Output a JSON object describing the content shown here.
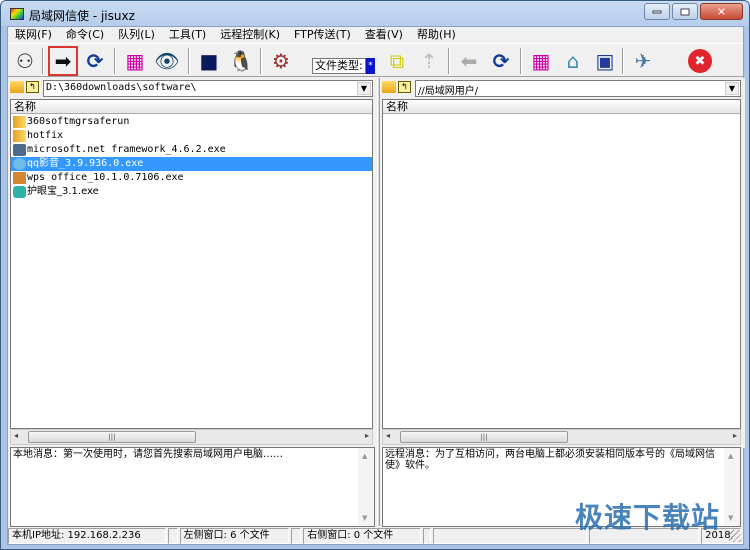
{
  "window": {
    "title": "局域网信使 - jisuxz",
    "controls": {
      "minimize": "minimize",
      "maximize": "maximize",
      "close": "close"
    }
  },
  "menu": [
    {
      "label": "联网(F)"
    },
    {
      "label": "命令(C)"
    },
    {
      "label": "队列(L)"
    },
    {
      "label": "工具(T)"
    },
    {
      "label": "远程控制(K)"
    },
    {
      "label": "FTP传送(T)"
    },
    {
      "label": "查看(V)"
    },
    {
      "label": "帮助(H)"
    }
  ],
  "toolbar": {
    "left": [
      {
        "icon": "network-computers-icon",
        "glyph": "⚇"
      },
      {
        "icon": "send-arrow-icon",
        "glyph": "➡",
        "selected": true
      },
      {
        "icon": "refresh-icon",
        "glyph": "⟳"
      },
      {
        "icon": "color-monitor-icon",
        "glyph": "▦"
      },
      {
        "icon": "eye-folder-icon",
        "glyph": "👁"
      },
      {
        "icon": "screen-monitor-icon",
        "glyph": "■"
      },
      {
        "icon": "penguin-icon",
        "glyph": "🐧"
      },
      {
        "icon": "tools-icon",
        "glyph": "⚙"
      }
    ],
    "file_type_label": "文件类型:",
    "file_type_value": "*",
    "right": [
      {
        "icon": "computers-icon",
        "glyph": "⧉"
      },
      {
        "icon": "upload-disabled-icon",
        "glyph": "⇡"
      },
      {
        "icon": "back-arrow-disabled-icon",
        "glyph": "⬅"
      },
      {
        "icon": "refresh-icon",
        "glyph": "⟳"
      },
      {
        "icon": "color-monitor-icon",
        "glyph": "▦"
      },
      {
        "icon": "folder-icon",
        "glyph": "⌂"
      },
      {
        "icon": "remote-screen-icon",
        "glyph": "▣"
      },
      {
        "icon": "plane-icon",
        "glyph": "✈"
      },
      {
        "icon": "close-red-icon",
        "glyph": "✖"
      }
    ]
  },
  "left_pane": {
    "path": "D:\\360downloads\\software\\",
    "column": "名称",
    "items": [
      {
        "name": "360softmgrsaferun",
        "type": "folder"
      },
      {
        "name": "hotfix",
        "type": "folder"
      },
      {
        "name": "microsoft.net framework_4.6.2.exe",
        "type": "net"
      },
      {
        "name": "qq影音_3.9.936.0.exe",
        "type": "qq",
        "selected": true
      },
      {
        "name": "wps office_10.1.0.7106.exe",
        "type": "wps"
      },
      {
        "name": "护眼宝_3.1.exe",
        "type": "eye"
      }
    ],
    "message": "本地消息：第一次使用时，请您首先搜索局域网用户电脑……"
  },
  "right_pane": {
    "path": "//局域网用户/",
    "column": "名称",
    "items": [],
    "message": "远程消息：为了互相访问，两台电脑上都必须安装相同版本号的《局域网信使》软件。"
  },
  "status": {
    "ip": "本机IP地址: 192.168.2.236",
    "left_count": "左侧窗口: 6 个文件",
    "right_count": "右侧窗口: 0 个文件",
    "year": "2018,"
  },
  "watermark": "极速下载站"
}
